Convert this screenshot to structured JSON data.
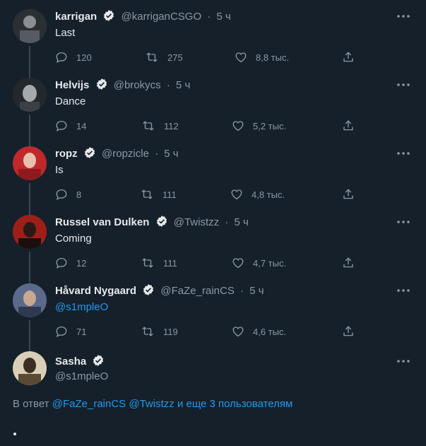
{
  "tweets": [
    {
      "name": "karrigan",
      "handle": "@karriganCSGO",
      "time": "5 ч",
      "text": "Last",
      "replies": "120",
      "retweets": "275",
      "likes": "8,8 тыс.",
      "avatar_color": "#3a3f44"
    },
    {
      "name": "Helvijs",
      "handle": "@brokyсs",
      "time": "5 ч",
      "text": "Dance",
      "replies": "14",
      "retweets": "112",
      "likes": "5,2 тыс.",
      "avatar_color": "#4a4f55"
    },
    {
      "name": "ropz",
      "handle": "@ropzicle",
      "time": "5 ч",
      "text": "Is",
      "replies": "8",
      "retweets": "111",
      "likes": "4,8 тыс.",
      "avatar_color": "#c0282c"
    },
    {
      "name": "Russel van Dulken",
      "handle": "@Twistzz",
      "time": "5 ч",
      "text": "Coming",
      "replies": "12",
      "retweets": "111",
      "likes": "4,7 тыс.",
      "avatar_color": "#b3261e"
    },
    {
      "name": "Håvard Nygaard",
      "handle": "@FaZe_rainCS",
      "time": "5 ч",
      "text": "@s1mpleO",
      "replies": "71",
      "retweets": "119",
      "likes": "4,6 тыс.",
      "avatar_color": "#6d7a9a"
    }
  ],
  "compose": {
    "name": "Sasha",
    "handle": "@s1mpleO",
    "avatar_color": "#6b5a40"
  },
  "reply_to": {
    "prefix": "В ответ",
    "user1": "@FaZe_rainCS",
    "user2": "@Twistzz",
    "suffix": "и еще 3 пользователям"
  },
  "colors": {
    "background": "#15202b",
    "accent": "#1d9bf0",
    "muted": "#8b98a5"
  },
  "icons": [
    "verified-icon",
    "more-icon",
    "reply-icon",
    "retweet-icon",
    "like-icon",
    "share-icon"
  ]
}
